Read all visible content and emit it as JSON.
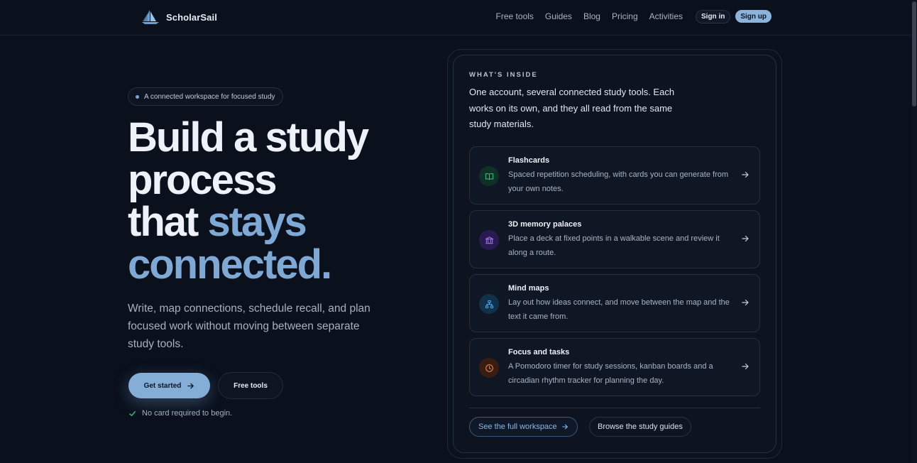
{
  "brand": {
    "name": "ScholarSail",
    "logo_icon": "sailboat-icon"
  },
  "nav": {
    "items": [
      "Free tools",
      "Guides",
      "Blog",
      "Pricing",
      "Activities"
    ]
  },
  "auth": {
    "sign_in": "Sign in",
    "sign_up": "Sign up"
  },
  "hero": {
    "pill": "A connected workspace for focused study",
    "headline_line1": "Build a study",
    "headline_line2": "process",
    "headline_line3_plain": "that ",
    "headline_line3_accent": "stays",
    "headline_line4_accent": "connected.",
    "subtext": "Write, map connections, schedule recall, and plan focused work without moving between separate study tools.",
    "cta_primary": "Get started",
    "cta_secondary": "Free tools",
    "note": "No card required to begin."
  },
  "inside": {
    "eyebrow": "WHAT'S INSIDE",
    "intro": "One account, several connected study tools. Each works on its own, and they all read from the same study materials.",
    "tools": [
      {
        "title": "Flashcards",
        "description": "Spaced repetition scheduling, with cards you can generate from your own notes.",
        "icon": "book-open-icon",
        "color": "#3fbf7f"
      },
      {
        "title": "3D memory palaces",
        "description": "Place a deck at fixed points in a walkable scene and review it along a route.",
        "icon": "landmark-icon",
        "color": "#a77cf0"
      },
      {
        "title": "Mind maps",
        "description": "Lay out how ideas connect, and move between the map and the text it came from.",
        "icon": "hierarchy-icon",
        "color": "#5aa8e6"
      },
      {
        "title": "Focus and tasks",
        "description": "A Pomodoro timer for study sessions, kanban boards and a circadian rhythm tracker for planning the day.",
        "icon": "clock-icon",
        "color": "#f08a4b"
      }
    ],
    "btn_workspace": "See the full workspace",
    "btn_guides": "Browse the study guides"
  },
  "colors": {
    "accent": "#7fa9d4",
    "background": "#0a101c"
  }
}
